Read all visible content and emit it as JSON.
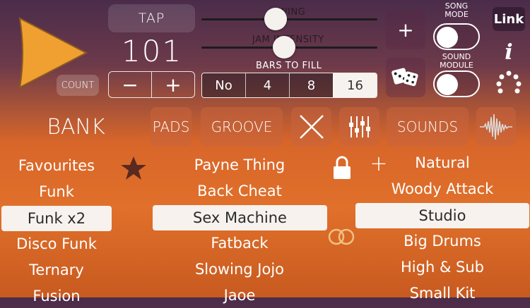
{
  "transport": {
    "tap_label": "TAP",
    "bpm": "101",
    "count_label": "COUNT",
    "minus": "−",
    "plus": "+"
  },
  "sliders": {
    "swing_label": "SWING",
    "swing_value": 0.42,
    "jam_label": "JAM INTENSITY",
    "jam_value": 0.47
  },
  "bars_to_fill": {
    "label": "BARS TO FILL",
    "options": [
      "No",
      "4",
      "8",
      "16"
    ],
    "selected": "16"
  },
  "right": {
    "add_label": "+",
    "song_mode_label": "SONG\nMODE",
    "sound_module_label": "SOUND\nMODULE",
    "link_label": "Link",
    "info_label": "i",
    "dice_icon": "dice-icon",
    "spinner_icon": "dots-arc-icon"
  },
  "nav": {
    "bank": "BANK",
    "pads": "PADS",
    "groove": "GROOVE",
    "sounds": "SOUNDS"
  },
  "banks": {
    "items": [
      "Favourites",
      "Funk",
      "Funk x2",
      "Disco Funk",
      "Ternary",
      "Fusion"
    ],
    "selected": "Funk x2"
  },
  "grooves": {
    "items": [
      "Payne Thing",
      "Back Cheat",
      "Sex Machine",
      "Fatback",
      "Slowing Jojo",
      "Jaoe"
    ],
    "selected": "Sex Machine"
  },
  "sounds": {
    "add_label": "+",
    "items": [
      "Natural",
      "Woody Attack",
      "Studio",
      "Big Drums",
      "High & Sub",
      "Small Kit"
    ],
    "selected": "Studio"
  },
  "colors": {
    "accent": "#f0a030",
    "star": "#5a2a20",
    "selected_bg": "#f7f2ee"
  }
}
